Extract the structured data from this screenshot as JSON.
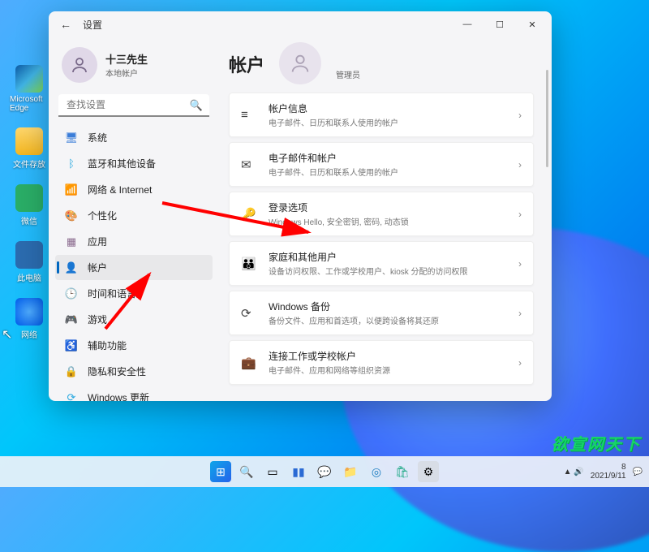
{
  "window": {
    "title": "设置",
    "controls": {
      "min": "—",
      "max": "☐",
      "close": "✕"
    }
  },
  "user": {
    "name": "十三先生",
    "sub": "本地帐户"
  },
  "search": {
    "placeholder": "查找设置"
  },
  "nav": [
    {
      "icon": "🖥",
      "label": "系统",
      "color": "#3b7dd8"
    },
    {
      "icon": "ᛒ",
      "label": "蓝牙和其他设备",
      "color": "#2aa9e0"
    },
    {
      "icon": "📶",
      "label": "网络 & Internet",
      "color": "#5aa457"
    },
    {
      "icon": "🎨",
      "label": "个性化",
      "color": "#4a6a9e"
    },
    {
      "icon": "▦",
      "label": "应用",
      "color": "#8a6a8e"
    },
    {
      "icon": "👤",
      "label": "帐户",
      "color": "#3a9a6a",
      "active": true
    },
    {
      "icon": "🕒",
      "label": "时间和语言",
      "color": "#555"
    },
    {
      "icon": "🎮",
      "label": "游戏",
      "color": "#666"
    },
    {
      "icon": "♿",
      "label": "辅助功能",
      "color": "#4a7ab8"
    },
    {
      "icon": "🔒",
      "label": "隐私和安全性",
      "color": "#555"
    },
    {
      "icon": "⟳",
      "label": "Windows 更新",
      "color": "#2aa9e0"
    }
  ],
  "main": {
    "heading": "帐户",
    "admin": "管理员",
    "cards": [
      {
        "icon": "≡",
        "title": "帐户信息",
        "sub": "电子邮件、日历和联系人使用的帐户"
      },
      {
        "icon": "✉",
        "title": "电子邮件和帐户",
        "sub": "电子邮件、日历和联系人使用的帐户"
      },
      {
        "icon": "🔑",
        "title": "登录选项",
        "sub": "Windows Hello, 安全密钥, 密码, 动态锁"
      },
      {
        "icon": "👪",
        "title": "家庭和其他用户",
        "sub": "设备访问权限、工作或学校用户、kiosk 分配的访问权限"
      },
      {
        "icon": "⟳",
        "title": "Windows 备份",
        "sub": "备份文件、应用和首选项，以便跨设备将其还原"
      },
      {
        "icon": "💼",
        "title": "连接工作或学校帐户",
        "sub": "电子邮件、应用和网络等组织资源"
      }
    ]
  },
  "desktop": {
    "icons": [
      {
        "name": "edge",
        "label": "Microsoft Edge",
        "cls": "edge-i"
      },
      {
        "name": "folder",
        "label": "文件存放",
        "cls": "folder-i"
      },
      {
        "name": "wechat",
        "label": "微信",
        "cls": "wechat-i"
      },
      {
        "name": "this-pc",
        "label": "此电脑",
        "cls": "pc-i"
      },
      {
        "name": "network",
        "label": "网络",
        "cls": "net-i"
      }
    ]
  },
  "taskbar": {
    "items": [
      "start",
      "search",
      "taskview",
      "widgets",
      "chat",
      "explorer",
      "edge",
      "store",
      "settings"
    ],
    "tray": {
      "time": "8",
      "date": "2021/9/11"
    }
  },
  "watermark": "欲宣网天下"
}
